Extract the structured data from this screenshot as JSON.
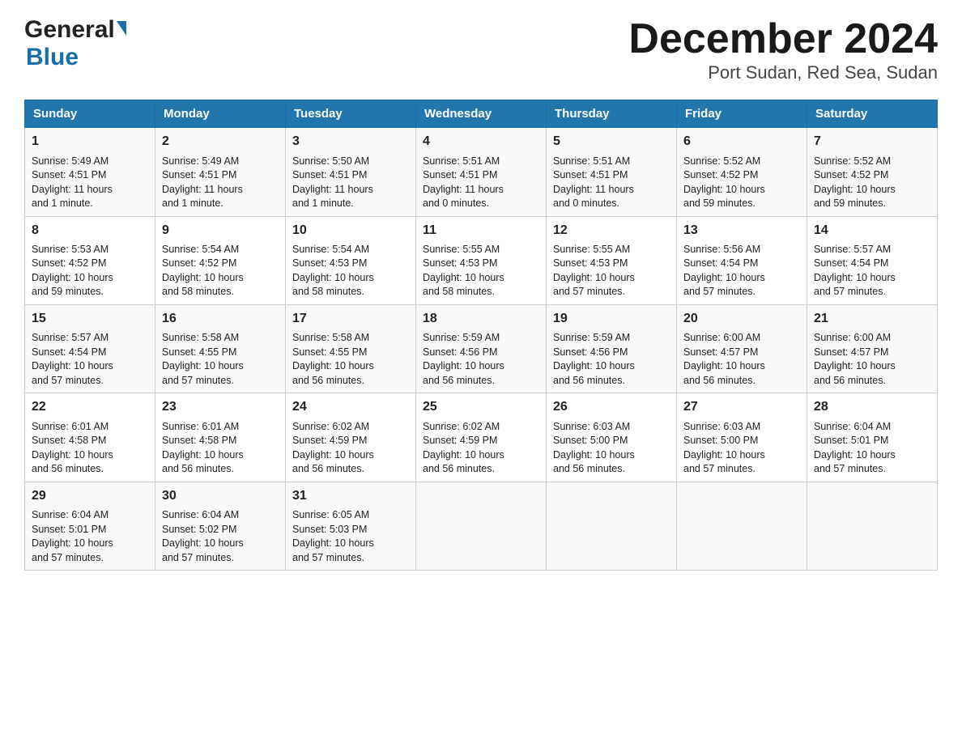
{
  "logo": {
    "general": "General",
    "blue": "Blue",
    "triangle": "▶"
  },
  "title": "December 2024",
  "subtitle": "Port Sudan, Red Sea, Sudan",
  "weekdays": [
    "Sunday",
    "Monday",
    "Tuesday",
    "Wednesday",
    "Thursday",
    "Friday",
    "Saturday"
  ],
  "weeks": [
    [
      {
        "day": "1",
        "info": "Sunrise: 5:49 AM\nSunset: 4:51 PM\nDaylight: 11 hours\nand 1 minute."
      },
      {
        "day": "2",
        "info": "Sunrise: 5:49 AM\nSunset: 4:51 PM\nDaylight: 11 hours\nand 1 minute."
      },
      {
        "day": "3",
        "info": "Sunrise: 5:50 AM\nSunset: 4:51 PM\nDaylight: 11 hours\nand 1 minute."
      },
      {
        "day": "4",
        "info": "Sunrise: 5:51 AM\nSunset: 4:51 PM\nDaylight: 11 hours\nand 0 minutes."
      },
      {
        "day": "5",
        "info": "Sunrise: 5:51 AM\nSunset: 4:51 PM\nDaylight: 11 hours\nand 0 minutes."
      },
      {
        "day": "6",
        "info": "Sunrise: 5:52 AM\nSunset: 4:52 PM\nDaylight: 10 hours\nand 59 minutes."
      },
      {
        "day": "7",
        "info": "Sunrise: 5:52 AM\nSunset: 4:52 PM\nDaylight: 10 hours\nand 59 minutes."
      }
    ],
    [
      {
        "day": "8",
        "info": "Sunrise: 5:53 AM\nSunset: 4:52 PM\nDaylight: 10 hours\nand 59 minutes."
      },
      {
        "day": "9",
        "info": "Sunrise: 5:54 AM\nSunset: 4:52 PM\nDaylight: 10 hours\nand 58 minutes."
      },
      {
        "day": "10",
        "info": "Sunrise: 5:54 AM\nSunset: 4:53 PM\nDaylight: 10 hours\nand 58 minutes."
      },
      {
        "day": "11",
        "info": "Sunrise: 5:55 AM\nSunset: 4:53 PM\nDaylight: 10 hours\nand 58 minutes."
      },
      {
        "day": "12",
        "info": "Sunrise: 5:55 AM\nSunset: 4:53 PM\nDaylight: 10 hours\nand 57 minutes."
      },
      {
        "day": "13",
        "info": "Sunrise: 5:56 AM\nSunset: 4:54 PM\nDaylight: 10 hours\nand 57 minutes."
      },
      {
        "day": "14",
        "info": "Sunrise: 5:57 AM\nSunset: 4:54 PM\nDaylight: 10 hours\nand 57 minutes."
      }
    ],
    [
      {
        "day": "15",
        "info": "Sunrise: 5:57 AM\nSunset: 4:54 PM\nDaylight: 10 hours\nand 57 minutes."
      },
      {
        "day": "16",
        "info": "Sunrise: 5:58 AM\nSunset: 4:55 PM\nDaylight: 10 hours\nand 57 minutes."
      },
      {
        "day": "17",
        "info": "Sunrise: 5:58 AM\nSunset: 4:55 PM\nDaylight: 10 hours\nand 56 minutes."
      },
      {
        "day": "18",
        "info": "Sunrise: 5:59 AM\nSunset: 4:56 PM\nDaylight: 10 hours\nand 56 minutes."
      },
      {
        "day": "19",
        "info": "Sunrise: 5:59 AM\nSunset: 4:56 PM\nDaylight: 10 hours\nand 56 minutes."
      },
      {
        "day": "20",
        "info": "Sunrise: 6:00 AM\nSunset: 4:57 PM\nDaylight: 10 hours\nand 56 minutes."
      },
      {
        "day": "21",
        "info": "Sunrise: 6:00 AM\nSunset: 4:57 PM\nDaylight: 10 hours\nand 56 minutes."
      }
    ],
    [
      {
        "day": "22",
        "info": "Sunrise: 6:01 AM\nSunset: 4:58 PM\nDaylight: 10 hours\nand 56 minutes."
      },
      {
        "day": "23",
        "info": "Sunrise: 6:01 AM\nSunset: 4:58 PM\nDaylight: 10 hours\nand 56 minutes."
      },
      {
        "day": "24",
        "info": "Sunrise: 6:02 AM\nSunset: 4:59 PM\nDaylight: 10 hours\nand 56 minutes."
      },
      {
        "day": "25",
        "info": "Sunrise: 6:02 AM\nSunset: 4:59 PM\nDaylight: 10 hours\nand 56 minutes."
      },
      {
        "day": "26",
        "info": "Sunrise: 6:03 AM\nSunset: 5:00 PM\nDaylight: 10 hours\nand 56 minutes."
      },
      {
        "day": "27",
        "info": "Sunrise: 6:03 AM\nSunset: 5:00 PM\nDaylight: 10 hours\nand 57 minutes."
      },
      {
        "day": "28",
        "info": "Sunrise: 6:04 AM\nSunset: 5:01 PM\nDaylight: 10 hours\nand 57 minutes."
      }
    ],
    [
      {
        "day": "29",
        "info": "Sunrise: 6:04 AM\nSunset: 5:01 PM\nDaylight: 10 hours\nand 57 minutes."
      },
      {
        "day": "30",
        "info": "Sunrise: 6:04 AM\nSunset: 5:02 PM\nDaylight: 10 hours\nand 57 minutes."
      },
      {
        "day": "31",
        "info": "Sunrise: 6:05 AM\nSunset: 5:03 PM\nDaylight: 10 hours\nand 57 minutes."
      },
      {
        "day": "",
        "info": ""
      },
      {
        "day": "",
        "info": ""
      },
      {
        "day": "",
        "info": ""
      },
      {
        "day": "",
        "info": ""
      }
    ]
  ]
}
